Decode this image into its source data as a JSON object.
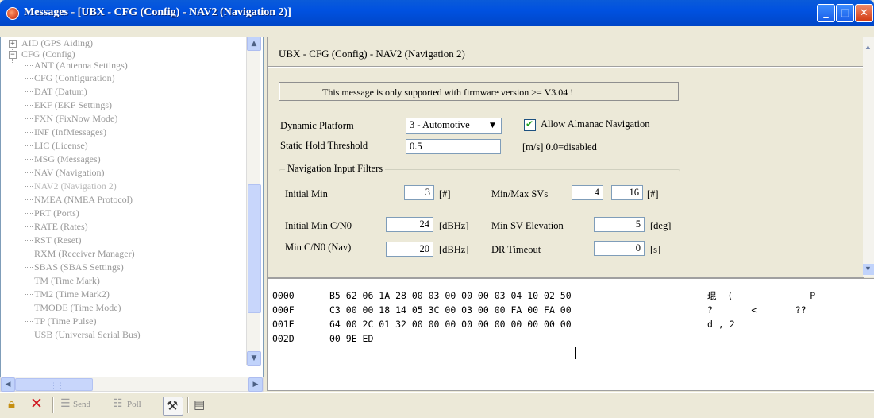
{
  "window": {
    "title": "Messages - [UBX - CFG (Config) - NAV2 (Navigation 2)]",
    "controls": {
      "minimize": "_",
      "maximize": "□",
      "close": "✕"
    }
  },
  "tree": {
    "items": [
      {
        "label": "AID (GPS Aiding)",
        "expander": "+"
      },
      {
        "label": "CFG (Config)",
        "expander": "−"
      },
      {
        "label": "ANT (Antenna Settings)"
      },
      {
        "label": "CFG (Configuration)"
      },
      {
        "label": "DAT (Datum)"
      },
      {
        "label": "EKF (EKF Settings)"
      },
      {
        "label": "FXN (FixNow Mode)"
      },
      {
        "label": "INF (InfMessages)"
      },
      {
        "label": "LIC (License)"
      },
      {
        "label": "MSG (Messages)"
      },
      {
        "label": "NAV (Navigation)"
      },
      {
        "label": "NAV2 (Navigation 2)",
        "selected": true
      },
      {
        "label": "NMEA (NMEA Protocol)"
      },
      {
        "label": "PRT (Ports)"
      },
      {
        "label": "RATE (Rates)"
      },
      {
        "label": "RST (Reset)"
      },
      {
        "label": "RXM (Receiver Manager)"
      },
      {
        "label": "SBAS (SBAS Settings)"
      },
      {
        "label": "TM (Time Mark)"
      },
      {
        "label": "TM2 (Time Mark2)"
      },
      {
        "label": "TMODE (Time Mode)"
      },
      {
        "label": "TP (Time Pulse)"
      },
      {
        "label": "USB (Universal Serial Bus)"
      }
    ]
  },
  "config": {
    "header": "UBX - CFG (Config) - NAV2 (Navigation 2)",
    "firmware_note": "This message is only supported with firmware version >= V3.04 !",
    "dynamic_platform": {
      "label": "Dynamic Platform",
      "value": "3 - Automotive"
    },
    "almanac": {
      "label": "Allow Almanac Navigation",
      "checked": true
    },
    "static_hold": {
      "label": "Static Hold Threshold",
      "value": "0.5",
      "unit": "[m/s] 0.0=disabled"
    },
    "filters": {
      "title": "Navigation Input Filters",
      "initial_min": {
        "label": "Initial Min",
        "value": "3",
        "unit": "[#]"
      },
      "min_max_svs": {
        "label": "Min/Max SVs",
        "min": "4",
        "max": "16",
        "unit": "[#]"
      },
      "initial_min_cn0": {
        "label": "Initial Min C/N0",
        "value": "24",
        "unit": "[dBHz]"
      },
      "min_sv_elevation": {
        "label": "Min SV Elevation",
        "value": "5",
        "unit": "[deg]"
      },
      "min_cn0_nav": {
        "label": "Min C/N0 (Nav)",
        "value": "20",
        "unit": "[dBHz]"
      },
      "dr_timeout": {
        "label": "DR Timeout",
        "value": "0",
        "unit": "[s]"
      }
    }
  },
  "hex": {
    "rows": [
      {
        "addr": "0000",
        "bytes": "B5 62 06 1A 28 00 03 00 00 00 03 04 10 02 50",
        "ascii": "琨  (              P"
      },
      {
        "addr": "000F",
        "bytes": "C3 00 00 18 14 05 3C 00 03 00 00 FA 00 FA 00",
        "ascii": "?       <       ??"
      },
      {
        "addr": "001E",
        "bytes": "64 00 2C 01 32 00 00 00 00 00 00 00 00 00 00",
        "ascii": "d , 2"
      },
      {
        "addr": "002D",
        "bytes": "00 9E ED",
        "ascii": ""
      }
    ]
  },
  "toolbar": {
    "send_label": "Send",
    "poll_label": "Poll",
    "icons": [
      "lock-icon",
      "delete-icon",
      "send-icon",
      "poll-icon",
      "settings-icon",
      "capture-icon"
    ]
  }
}
